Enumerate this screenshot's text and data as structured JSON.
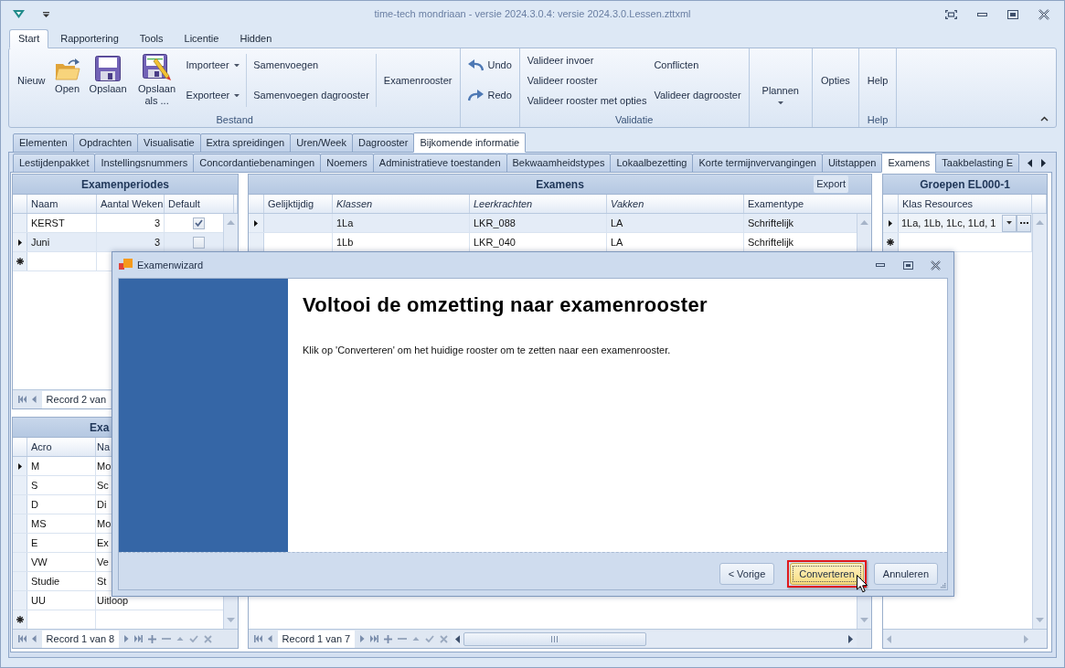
{
  "window": {
    "title": "time-tech mondriaan - versie 2024.3.0.4: versie 2024.3.0.Lessen.zttxml"
  },
  "ribbon_tabs": [
    {
      "label": "Start",
      "selected": true
    },
    {
      "label": "Rapportering",
      "selected": false
    },
    {
      "label": "Tools",
      "selected": false
    },
    {
      "label": "Licentie",
      "selected": false
    },
    {
      "label": "Hidden",
      "selected": false
    }
  ],
  "ribbon_groups": [
    {
      "label": "Bestand",
      "sections": [
        {
          "kind": "column",
          "items": [
            {
              "label": "Nieuw",
              "kind": "large"
            }
          ]
        },
        {
          "kind": "column",
          "items": [
            {
              "label": "Open",
              "kind": "large"
            }
          ]
        },
        {
          "kind": "column",
          "items": [
            {
              "label": "Opslaan",
              "kind": "large"
            }
          ]
        },
        {
          "kind": "column",
          "items": [
            {
              "label": "Opslaan als ...",
              "kind": "large"
            }
          ]
        },
        {
          "kind": "column",
          "items": [
            {
              "label": "Importeer",
              "kind": "menu"
            },
            {
              "label": "Exporteer",
              "kind": "menu"
            }
          ]
        },
        {
          "kind": "separator"
        },
        {
          "kind": "column",
          "items": [
            {
              "label": "Samenvoegen",
              "kind": "small"
            },
            {
              "label": "Samenvoegen dagrooster",
              "kind": "small"
            }
          ]
        },
        {
          "kind": "separator"
        },
        {
          "kind": "column",
          "items": [
            {
              "label": "Examenrooster",
              "kind": "large"
            }
          ]
        }
      ]
    },
    {
      "sections": [
        {
          "kind": "column",
          "items": [
            {
              "label": "Undo",
              "kind": "small"
            },
            {
              "label": "Redo",
              "kind": "small"
            }
          ]
        }
      ]
    },
    {
      "label": "Validatie",
      "sections": [
        {
          "kind": "column",
          "items": [
            {
              "label": "Valideer invoer",
              "kind": "small"
            },
            {
              "label": "Valideer rooster",
              "kind": "small"
            },
            {
              "label": "Valideer rooster met opties",
              "kind": "small"
            }
          ]
        },
        {
          "kind": "column",
          "items": [
            {
              "label": "Conflicten",
              "kind": "small"
            },
            {
              "label": "Valideer dagrooster",
              "kind": "small"
            }
          ]
        }
      ]
    },
    {
      "sections": [
        {
          "kind": "column",
          "items": [
            {
              "label": "Plannen",
              "kind": "large_menu"
            }
          ]
        }
      ]
    },
    {
      "sections": [
        {
          "kind": "column",
          "items": [
            {
              "label": "Opties",
              "kind": "large"
            }
          ]
        }
      ]
    },
    {
      "label": "Help",
      "sections": [
        {
          "kind": "column",
          "items": [
            {
              "label": "Help",
              "kind": "large"
            }
          ]
        }
      ]
    }
  ],
  "main_tabs": [
    {
      "label": "Elementen",
      "selected": false
    },
    {
      "label": "Opdrachten",
      "selected": false
    },
    {
      "label": "Visualisatie",
      "selected": false
    },
    {
      "label": "Extra spreidingen",
      "selected": false
    },
    {
      "label": "Uren/Week",
      "selected": false
    },
    {
      "label": "Dagrooster",
      "selected": false
    },
    {
      "label": "Bijkomende informatie",
      "selected": true
    }
  ],
  "sub_tabs": [
    {
      "label": "Lestijdenpakket",
      "selected": false
    },
    {
      "label": "Instellingsnummers",
      "selected": false
    },
    {
      "label": "Concordantiebenamingen",
      "selected": false
    },
    {
      "label": "Noemers",
      "selected": false
    },
    {
      "label": "Administratieve toestanden",
      "selected": false
    },
    {
      "label": "Bekwaamheidstypes",
      "selected": false
    },
    {
      "label": "Lokaalbezetting",
      "selected": false
    },
    {
      "label": "Korte termijnvervangingen",
      "selected": false
    },
    {
      "label": "Uitstappen",
      "selected": false
    },
    {
      "label": "Examens",
      "selected": true
    },
    {
      "label": "Taakbelasting E",
      "selected": false
    }
  ],
  "exam_periods": {
    "title": "Examenperiodes",
    "columns": [
      "Naam",
      "Aantal Weken",
      "Default"
    ],
    "rows": [
      {
        "name": "KERST",
        "weeks": "3",
        "default": true,
        "selected": false
      },
      {
        "name": "Juni",
        "weeks": "3",
        "default": false,
        "selected": true
      }
    ],
    "record": "Record 2 van"
  },
  "exam_types": {
    "title": "Exa",
    "columns": [
      "Acro",
      "Na"
    ],
    "rows": [
      {
        "acro": "M",
        "name": "Mo",
        "selected": true
      },
      {
        "acro": "S",
        "name": "Sc",
        "selected": false
      },
      {
        "acro": "D",
        "name": "Di",
        "selected": false
      },
      {
        "acro": "MS",
        "name": "Mo",
        "selected": false
      },
      {
        "acro": "E",
        "name": "Ex",
        "selected": false
      },
      {
        "acro": "VW",
        "name": "Ve",
        "selected": false
      },
      {
        "acro": "Studie",
        "name": "St",
        "selected": false
      },
      {
        "acro": "UU",
        "name": "Uitloop",
        "selected": false
      }
    ],
    "record": "Record 1 van 8"
  },
  "exams": {
    "title": "Examens",
    "export_button": "Export",
    "columns": [
      {
        "label": "Gelijktijdig",
        "italic": false
      },
      {
        "label": "Klassen",
        "italic": true
      },
      {
        "label": "Leerkrachten",
        "italic": true
      },
      {
        "label": "Vakken",
        "italic": true
      },
      {
        "label": "Examentype",
        "italic": false
      }
    ],
    "rows": [
      {
        "classes": "1La",
        "teachers": "LKR_088",
        "subjects": "LA",
        "exam_type": "Schriftelijk",
        "selected": true
      },
      {
        "classes": "1Lb",
        "teachers": "LKR_040",
        "subjects": "LA",
        "exam_type": "Schriftelijk",
        "selected": false
      }
    ],
    "record": "Record 1 van 7"
  },
  "groups": {
    "title": "Groepen EL000-1",
    "columns": [
      "Klas Resources"
    ],
    "rows": [
      {
        "classes": "1La, 1Lb, 1Lc, 1Ld, 1",
        "selected": true,
        "editing": true
      }
    ]
  },
  "dialog": {
    "title": "Examenwizard",
    "heading": "Voltooi de omzetting naar examenrooster",
    "text": "Klik op 'Converteren' om het huidige rooster om te zetten naar een examenrooster.",
    "buttons": [
      {
        "label": "< Vorige",
        "focused": false,
        "highlighted": false
      },
      {
        "label": "Converteren",
        "focused": true,
        "highlighted": true
      },
      {
        "label": "Annuleren",
        "focused": false,
        "highlighted": false
      }
    ]
  }
}
